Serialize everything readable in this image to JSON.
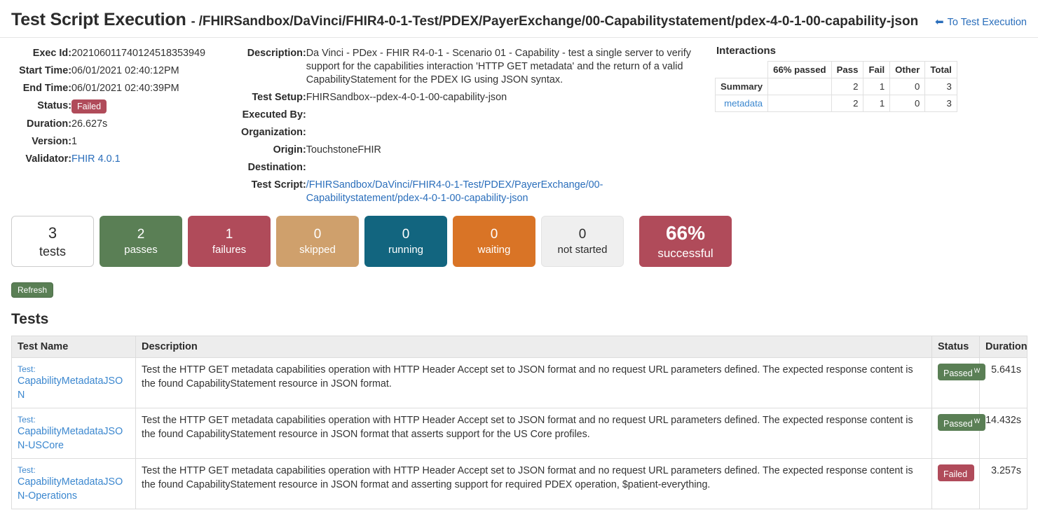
{
  "header": {
    "title": "Test Script Execution",
    "separator": "-",
    "subtitle": "/FHIRSandbox/DaVinci/FHIR4-0-1-Test/PDEX/PayerExchange/00-Capabilitystatement/pdex-4-0-1-00-capability-json",
    "back_link": "To Test Execution",
    "back_arrow": "arrow-left-icon"
  },
  "exec_info": {
    "exec_id_label": "Exec Id:",
    "exec_id": "202106011740124518353949",
    "start_time_label": "Start Time:",
    "start_time": "06/01/2021 02:40:12PM",
    "end_time_label": "End Time:",
    "end_time": "06/01/2021 02:40:39PM",
    "status_label": "Status:",
    "status": "Failed",
    "duration_label": "Duration:",
    "duration": "26.627s",
    "version_label": "Version:",
    "version": "1",
    "validator_label": "Validator:",
    "validator": "FHIR 4.0.1"
  },
  "script_info": {
    "description_label": "Description:",
    "description": "Da Vinci - PDex - FHIR R4-0-1 - Scenario 01 - Capability - test a single server to verify support for the capabilities interaction 'HTTP GET metadata' and the return of a valid CapabilityStatement for the PDEX IG using JSON syntax.",
    "test_setup_label": "Test Setup:",
    "test_setup": "FHIRSandbox--pdex-4-0-1-00-capability-json",
    "executed_by_label": "Executed By:",
    "executed_by": "",
    "organization_label": "Organization:",
    "organization": "",
    "origin_label": "Origin:",
    "origin": "TouchstoneFHIR",
    "destination_label": "Destination:",
    "destination": "",
    "test_script_label": "Test Script:",
    "test_script": "/FHIRSandbox/DaVinci/FHIR4-0-1-Test/PDEX/PayerExchange/00-Capabilitystatement/pdex-4-0-1-00-capability-json"
  },
  "interactions": {
    "title": "Interactions",
    "columns": [
      "",
      "66% passed",
      "Pass",
      "Fail",
      "Other",
      "Total"
    ],
    "percent_passed": 66,
    "rows": [
      {
        "label": "Summary",
        "is_link": false,
        "pass": "2",
        "fail": "1",
        "other": "0",
        "total": "3",
        "bar_percent": 66
      },
      {
        "label": "metadata",
        "is_link": true,
        "pass": "2",
        "fail": "1",
        "other": "0",
        "total": "3",
        "bar_percent": 66
      }
    ]
  },
  "stats": [
    {
      "num": "3",
      "label": "tests",
      "style": "tests"
    },
    {
      "num": "2",
      "label": "passes",
      "style": "pass"
    },
    {
      "num": "1",
      "label": "failures",
      "style": "fail"
    },
    {
      "num": "0",
      "label": "skipped",
      "style": "skip"
    },
    {
      "num": "0",
      "label": "running",
      "style": "run"
    },
    {
      "num": "0",
      "label": "waiting",
      "style": "wait"
    },
    {
      "num": "0",
      "label": "not started",
      "style": "notstart"
    },
    {
      "num": "66%",
      "label": "successful",
      "style": "success"
    }
  ],
  "refresh_label": "Refresh",
  "tests_heading": "Tests",
  "tests_table": {
    "columns": [
      "Test Name",
      "Description",
      "Status",
      "Duration"
    ],
    "rows": [
      {
        "prefix": "Test:",
        "name": "CapabilityMetadataJSON",
        "description": "Test the HTTP GET metadata capabilities operation with HTTP Header Accept set to JSON format and no request URL parameters defined. The expected response content is the found CapabilityStatement resource in JSON format.",
        "status": "Passed",
        "status_sup": "W",
        "status_kind": "passed",
        "duration": "5.641s"
      },
      {
        "prefix": "Test:",
        "name": "CapabilityMetadataJSON-USCore",
        "description": "Test the HTTP GET metadata capabilities operation with HTTP Header Accept set to JSON format and no request URL parameters defined. The expected response content is the found CapabilityStatement resource in JSON format that asserts support for the US Core profiles.",
        "status": "Passed",
        "status_sup": "W",
        "status_kind": "passed",
        "duration": "14.432s"
      },
      {
        "prefix": "Test:",
        "name": "CapabilityMetadataJSON-Operations",
        "description": "Test the HTTP GET metadata capabilities operation with HTTP Header Accept set to JSON format and no request URL parameters defined. The expected response content is the found CapabilityStatement resource in JSON format and asserting support for required PDEX operation, $patient-everything.",
        "status": "Failed",
        "status_sup": "",
        "status_kind": "failed",
        "duration": "3.257s"
      }
    ]
  },
  "colors": {
    "pass_green": "#5a7f55",
    "fail_red": "#b04b5a",
    "skip_tan": "#cfa06c",
    "running_blue": "#12657f",
    "waiting_orange": "#d97426",
    "not_started_grey": "#efefef",
    "link_blue": "#3b87cf"
  }
}
